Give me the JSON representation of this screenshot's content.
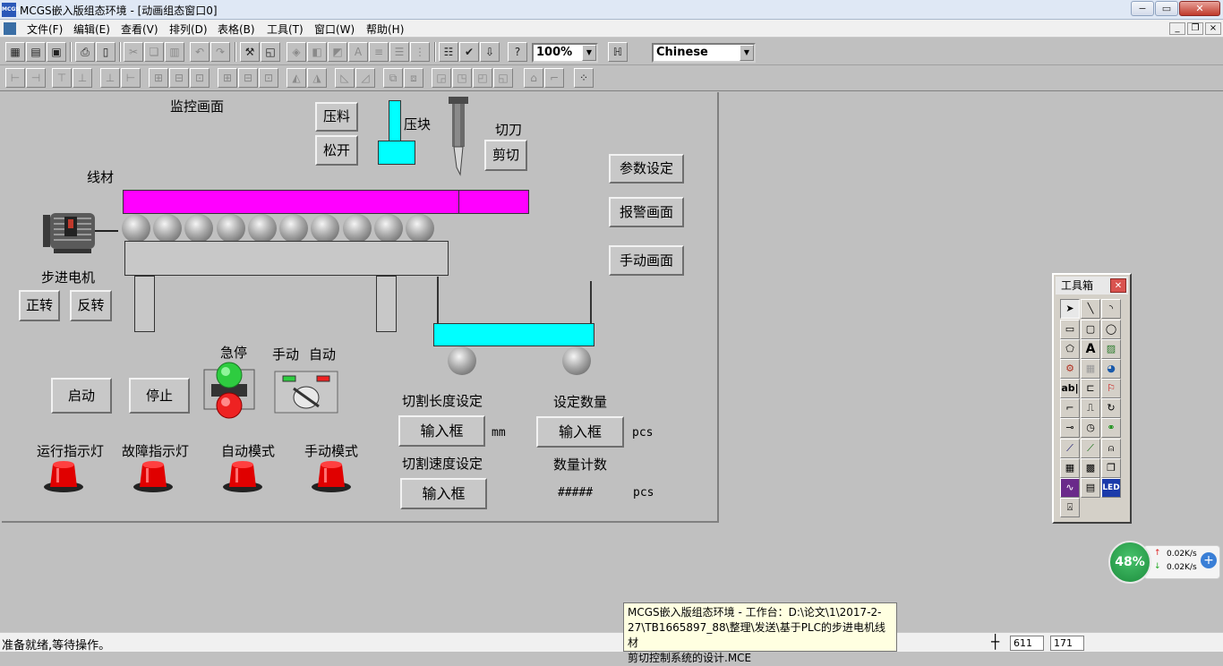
{
  "window": {
    "title": "MCGS嵌入版组态环境 - [动画组态窗口0]",
    "app_icon": "MCGS",
    "min": "−",
    "max": "▭",
    "close": "✕"
  },
  "menu": [
    "文件(F)",
    "编辑(E)",
    "查看(V)",
    "排列(D)",
    "表格(B)",
    "工具(T)",
    "窗口(W)",
    "帮助(H)"
  ],
  "toolbar": {
    "zoom": "100%",
    "language": "Chinese"
  },
  "screen": {
    "title": "监控画面",
    "buttons": {
      "press": "压料",
      "release": "松开",
      "cut": "剪切",
      "forward": "正转",
      "reverse": "反转",
      "start": "启动",
      "stop": "停止",
      "params": "参数设定",
      "alarm": "报警画面",
      "manual": "手动画面"
    },
    "labels": {
      "press_block": "压块",
      "cutter": "切刀",
      "wire": "线材",
      "motor": "步进电机",
      "estop": "急停",
      "manual": "手动",
      "auto": "自动",
      "cut_len": "切割长度设定",
      "cut_speed": "切割速度设定",
      "set_qty": "设定数量",
      "count": "数量计数",
      "unit_mm": "mm",
      "unit_pcs1": "pcs",
      "unit_pcs2": "pcs",
      "count_value": "#####",
      "lamp_run": "运行指示灯",
      "lamp_fault": "故障指示灯",
      "lamp_auto": "自动模式",
      "lamp_manual": "手动模式"
    },
    "inputs": {
      "len": "输入框",
      "qty": "输入框",
      "speed": "输入框"
    }
  },
  "toolbox": {
    "title": "工具箱",
    "close": "✕"
  },
  "net": {
    "percent": "48%",
    "up": "0.02K/s",
    "down": "0.02K/s"
  },
  "tooltip": [
    "MCGS嵌入版组态环境 - 工作台：D:\\论文\\1\\2017-2-",
    "27\\TB1665897_88\\整理\\发送\\基于PLC的步进电机线材",
    "剪切控制系统的设计.MCE"
  ],
  "status": {
    "text": "准备就绪,等待操作。",
    "x": "611",
    "y": "171"
  }
}
